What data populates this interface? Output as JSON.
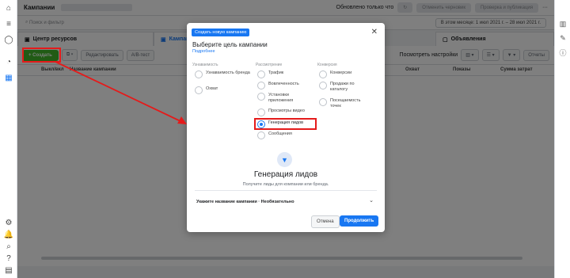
{
  "app": {
    "title": "Кампании"
  },
  "topbar": {
    "updated": "Обновлено только что",
    "discard": "Отменить черновик",
    "review": "Проверка и публикация",
    "more": "···"
  },
  "search": {
    "placeholder": "Поиск и фильтр",
    "daterange": "В этом месяце: 1 июл 2021 г. – 28 июл 2021 г."
  },
  "tabs": [
    {
      "label": "Центр ресурсов"
    },
    {
      "label": "Кампании"
    },
    {
      "label": "Объявления"
    }
  ],
  "toolbar": {
    "create": "+ Создать",
    "edit": "Редактировать",
    "ab": "A/B-тест",
    "view_settings": "Посмотреть настройки",
    "columns": "Отчеты"
  },
  "table": {
    "headers": [
      "Выкл/вкл",
      "Название кампании",
      "Охват",
      "Показы",
      "Сумма затрат"
    ]
  },
  "modal": {
    "badge": "Создать новую кампанию",
    "title": "Выберите цель кампании",
    "more": "Подробнее",
    "columns": [
      {
        "head": "Узнаваемость",
        "options": [
          "Узнаваемость бренда",
          "Охват"
        ]
      },
      {
        "head": "Рассмотрение",
        "options": [
          "Трафик",
          "Вовлеченность",
          "Установки приложения",
          "Просмотры видео",
          "Генерация лидов",
          "Сообщения"
        ]
      },
      {
        "head": "Конверсия",
        "options": [
          "Конверсии",
          "Продажи по каталогу",
          "Посещаемость точек"
        ]
      }
    ],
    "selected": "Генерация лидов",
    "big_title": "Генерация лидов",
    "subtitle": "Получите лиды для компании или бренда.",
    "name_label": "Укажите название кампании · Необязательно",
    "cancel": "Отмена",
    "continue": "Продолжить"
  }
}
